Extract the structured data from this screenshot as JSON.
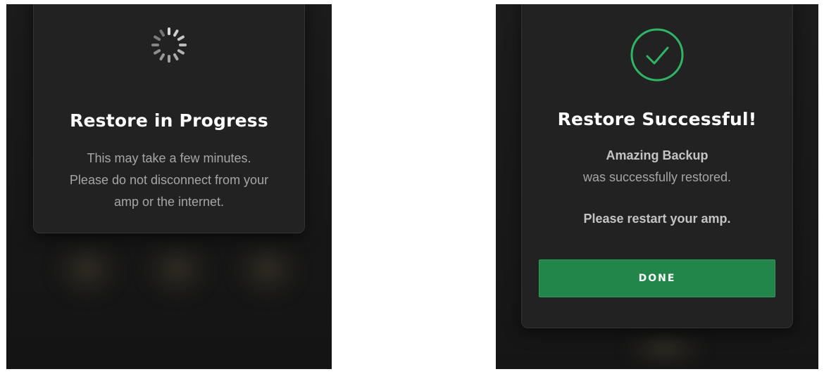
{
  "left_panel": {
    "title": "Restore in Progress",
    "message_lines": [
      "This may take a few minutes.",
      "Please do not disconnect from your",
      "amp or the internet."
    ],
    "icon": "loading-spinner-icon"
  },
  "right_panel": {
    "title": "Restore Successful!",
    "backup_name": "Amazing Backup",
    "result_text": "was successfully restored.",
    "instruction": "Please restart your amp.",
    "done_label": "DONE",
    "icon": "checkmark-circle-icon"
  },
  "colors": {
    "background": "#181818",
    "card": "#222222",
    "accent_green": "#22864a",
    "check_green": "#2fb566"
  }
}
